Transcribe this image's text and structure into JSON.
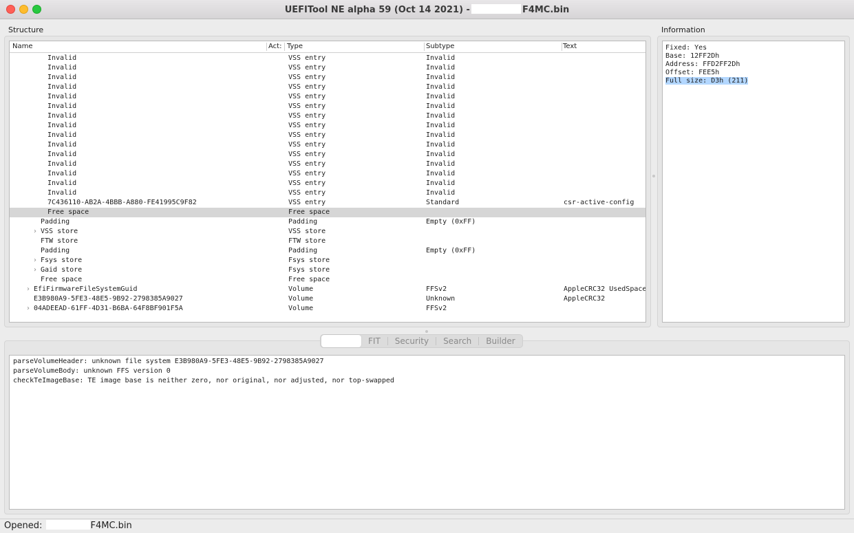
{
  "window": {
    "title_prefix": "UEFITool NE alpha 59 (Oct 14 2021) -",
    "title_suffix": "F4MC.bin"
  },
  "structure": {
    "label": "Structure",
    "columns": [
      "Name",
      "Act:",
      "Type",
      "Subtype",
      "Text"
    ],
    "rows": [
      {
        "name": "Invalid",
        "indent": 3,
        "expandable": false,
        "type": "VSS entry",
        "subtype": "Invalid",
        "text": "",
        "selected": false
      },
      {
        "name": "Invalid",
        "indent": 3,
        "expandable": false,
        "type": "VSS entry",
        "subtype": "Invalid",
        "text": "",
        "selected": false
      },
      {
        "name": "Invalid",
        "indent": 3,
        "expandable": false,
        "type": "VSS entry",
        "subtype": "Invalid",
        "text": "",
        "selected": false
      },
      {
        "name": "Invalid",
        "indent": 3,
        "expandable": false,
        "type": "VSS entry",
        "subtype": "Invalid",
        "text": "",
        "selected": false
      },
      {
        "name": "Invalid",
        "indent": 3,
        "expandable": false,
        "type": "VSS entry",
        "subtype": "Invalid",
        "text": "",
        "selected": false
      },
      {
        "name": "Invalid",
        "indent": 3,
        "expandable": false,
        "type": "VSS entry",
        "subtype": "Invalid",
        "text": "",
        "selected": false
      },
      {
        "name": "Invalid",
        "indent": 3,
        "expandable": false,
        "type": "VSS entry",
        "subtype": "Invalid",
        "text": "",
        "selected": false
      },
      {
        "name": "Invalid",
        "indent": 3,
        "expandable": false,
        "type": "VSS entry",
        "subtype": "Invalid",
        "text": "",
        "selected": false
      },
      {
        "name": "Invalid",
        "indent": 3,
        "expandable": false,
        "type": "VSS entry",
        "subtype": "Invalid",
        "text": "",
        "selected": false
      },
      {
        "name": "Invalid",
        "indent": 3,
        "expandable": false,
        "type": "VSS entry",
        "subtype": "Invalid",
        "text": "",
        "selected": false
      },
      {
        "name": "Invalid",
        "indent": 3,
        "expandable": false,
        "type": "VSS entry",
        "subtype": "Invalid",
        "text": "",
        "selected": false
      },
      {
        "name": "Invalid",
        "indent": 3,
        "expandable": false,
        "type": "VSS entry",
        "subtype": "Invalid",
        "text": "",
        "selected": false
      },
      {
        "name": "Invalid",
        "indent": 3,
        "expandable": false,
        "type": "VSS entry",
        "subtype": "Invalid",
        "text": "",
        "selected": false
      },
      {
        "name": "Invalid",
        "indent": 3,
        "expandable": false,
        "type": "VSS entry",
        "subtype": "Invalid",
        "text": "",
        "selected": false
      },
      {
        "name": "Invalid",
        "indent": 3,
        "expandable": false,
        "type": "VSS entry",
        "subtype": "Invalid",
        "text": "",
        "selected": false
      },
      {
        "name": "7C436110-AB2A-4BBB-A880-FE41995C9F82",
        "indent": 3,
        "expandable": false,
        "type": "VSS entry",
        "subtype": "Standard",
        "text": "csr-active-config",
        "selected": false
      },
      {
        "name": "Free space",
        "indent": 3,
        "expandable": false,
        "type": "Free space",
        "subtype": "",
        "text": "",
        "selected": true
      },
      {
        "name": "Padding",
        "indent": 2,
        "expandable": false,
        "type": "Padding",
        "subtype": "Empty (0xFF)",
        "text": "",
        "selected": false
      },
      {
        "name": "VSS store",
        "indent": 2,
        "expandable": true,
        "type": "VSS store",
        "subtype": "",
        "text": "",
        "selected": false
      },
      {
        "name": "FTW store",
        "indent": 2,
        "expandable": false,
        "type": "FTW store",
        "subtype": "",
        "text": "",
        "selected": false
      },
      {
        "name": "Padding",
        "indent": 2,
        "expandable": false,
        "type": "Padding",
        "subtype": "Empty (0xFF)",
        "text": "",
        "selected": false
      },
      {
        "name": "Fsys store",
        "indent": 2,
        "expandable": true,
        "type": "Fsys store",
        "subtype": "",
        "text": "",
        "selected": false
      },
      {
        "name": "Gaid store",
        "indent": 2,
        "expandable": true,
        "type": "Fsys store",
        "subtype": "",
        "text": "",
        "selected": false
      },
      {
        "name": "Free space",
        "indent": 2,
        "expandable": false,
        "type": "Free space",
        "subtype": "",
        "text": "",
        "selected": false
      },
      {
        "name": "EfiFirmwareFileSystemGuid",
        "indent": 1,
        "expandable": true,
        "type": "Volume",
        "subtype": "FFSv2",
        "text": "AppleCRC32 UsedSpace",
        "selected": false
      },
      {
        "name": "E3B980A9-5FE3-48E5-9B92-2798385A9027",
        "indent": 1,
        "expandable": false,
        "type": "Volume",
        "subtype": "Unknown",
        "text": "AppleCRC32",
        "selected": false
      },
      {
        "name": "04ADEEAD-61FF-4D31-B6BA-64F8BF901F5A",
        "indent": 1,
        "expandable": true,
        "type": "Volume",
        "subtype": "FFSv2",
        "text": "",
        "selected": false
      }
    ]
  },
  "information": {
    "label": "Information",
    "lines": [
      {
        "text": "Fixed: Yes",
        "highlighted": false
      },
      {
        "text": "Base: 12FF2Dh",
        "highlighted": false
      },
      {
        "text": "Address: FFD2FF2Dh",
        "highlighted": false
      },
      {
        "text": "Offset: FEE5h",
        "highlighted": false
      },
      {
        "text": "Full size: D3h (211)",
        "highlighted": true
      }
    ]
  },
  "tabs": [
    {
      "label": "",
      "active": true
    },
    {
      "label": "FIT",
      "active": false
    },
    {
      "label": "Security",
      "active": false
    },
    {
      "label": "Search",
      "active": false
    },
    {
      "label": "Builder",
      "active": false
    }
  ],
  "messages": [
    "parseVolumeHeader: unknown file system E3B980A9-5FE3-48E5-9B92-2798385A9027",
    "parseVolumeBody: unknown FFS version 0",
    "checkTeImageBase: TE image base is neither zero, nor original, nor adjusted, nor top-swapped"
  ],
  "status": {
    "prefix": "Opened:",
    "suffix": "F4MC.bin"
  },
  "colors": {
    "selection_row": "#d6d6d6",
    "text_highlight": "#b3d7ff",
    "close": "#ff5f57",
    "minimize": "#febc2e",
    "zoom": "#28c840"
  }
}
